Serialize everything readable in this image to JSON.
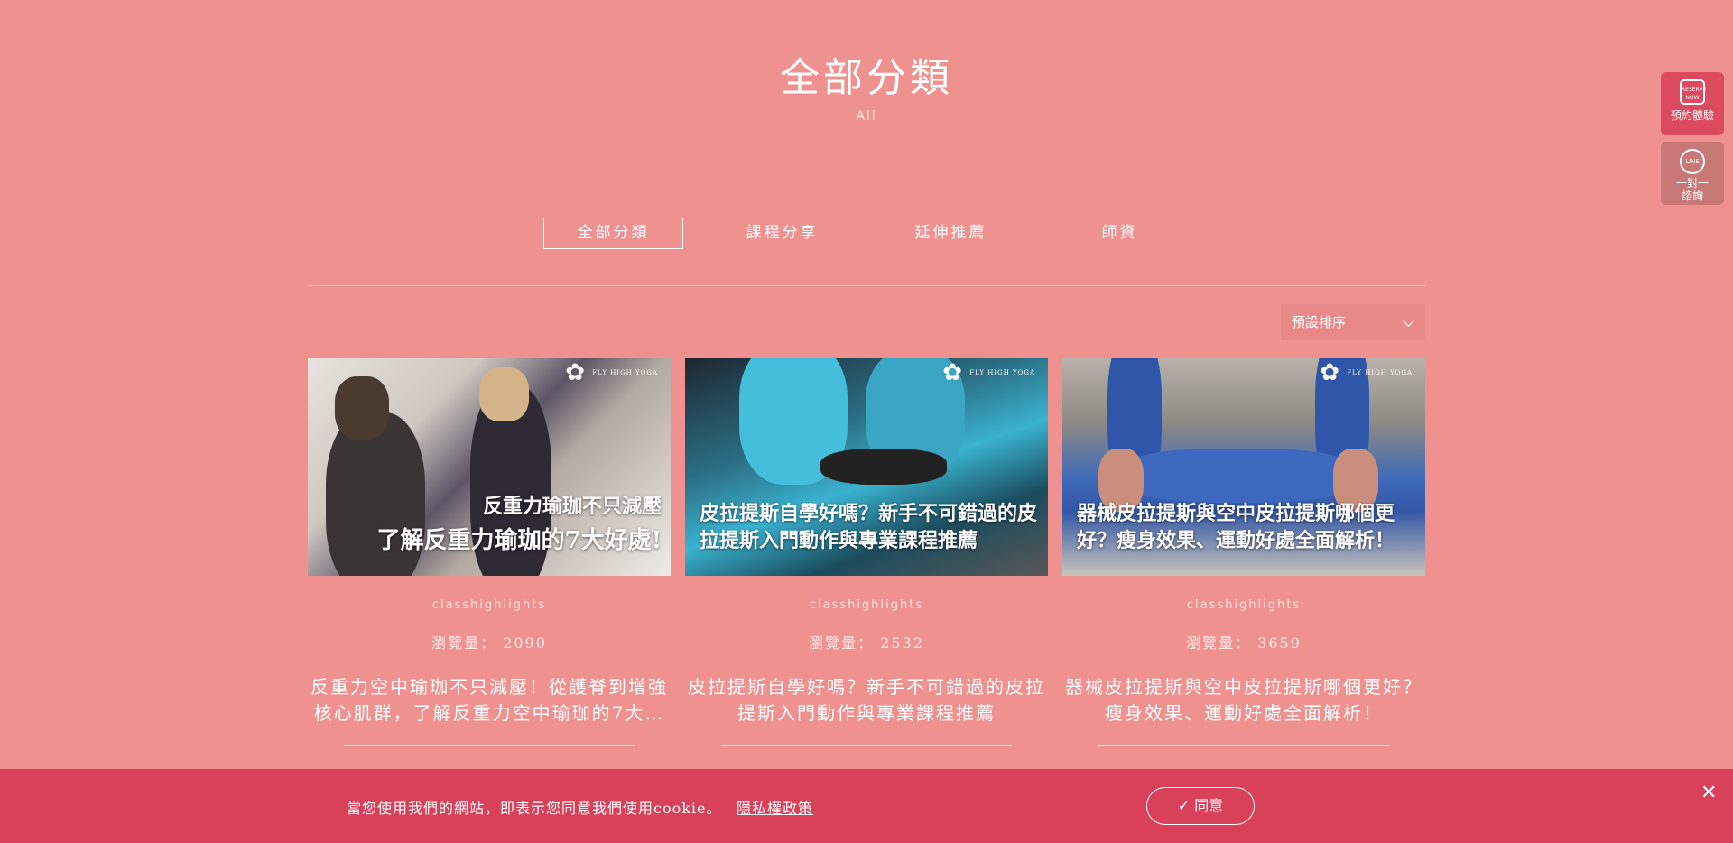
{
  "header": {
    "title": "全部分類",
    "subtitle": "All"
  },
  "tabs": [
    {
      "label": "全部分類",
      "active": true
    },
    {
      "label": "課程分享",
      "active": false
    },
    {
      "label": "延伸推薦",
      "active": false
    },
    {
      "label": "師資",
      "active": false
    }
  ],
  "sort": {
    "selected": "預設排序",
    "icon": "chevron-down-icon"
  },
  "cards": [
    {
      "image_text_line1": "反重力瑜珈不只減壓",
      "image_text_line2": "了解反重力瑜珈的7大好處!",
      "logo": "FLY HIGH YOGA",
      "category": "classhighlights",
      "views": "瀏覽量： 2090",
      "title": "反重力空中瑜珈不只減壓！從護脊到增強核心肌群，了解反重力空中瑜珈的7大…"
    },
    {
      "image_text_line1": "皮拉提斯自學好嗎？新手不可錯過的皮拉提斯入門動作與專業課程推薦",
      "logo": "FLY HIGH YOGA",
      "category": "classhighlights",
      "views": "瀏覽量： 2532",
      "title": "皮拉提斯自學好嗎？新手不可錯過的皮拉提斯入門動作與專業課程推薦"
    },
    {
      "image_text_line1": "器械皮拉提斯與空中皮拉提斯哪個更好？瘦身效果、運動好處全面解析！",
      "logo": "FLY HIGH YOGA",
      "category": "classhighlights",
      "views": "瀏覽量： 3659",
      "title": "器械皮拉提斯與空中皮拉提斯哪個更好？瘦身效果、運動好處全面解析！"
    }
  ],
  "cookie": {
    "message": "當您使用我們的網站，即表示您同意我們使用cookie。",
    "policy_link": "隱私權政策",
    "agree_label": "同意",
    "check_icon": "✓",
    "close_icon": "✕"
  },
  "side_buttons": {
    "reserve": {
      "icon_text": "RESERVE NOW",
      "label": "預約體驗"
    },
    "line": {
      "icon_text": "LINE",
      "label_line1": "一對一",
      "label_line2": "諮詢"
    }
  },
  "colors": {
    "background": "#ef918f",
    "cookie_bar": "#d9405a",
    "reserve_button": "#db4a5f"
  }
}
